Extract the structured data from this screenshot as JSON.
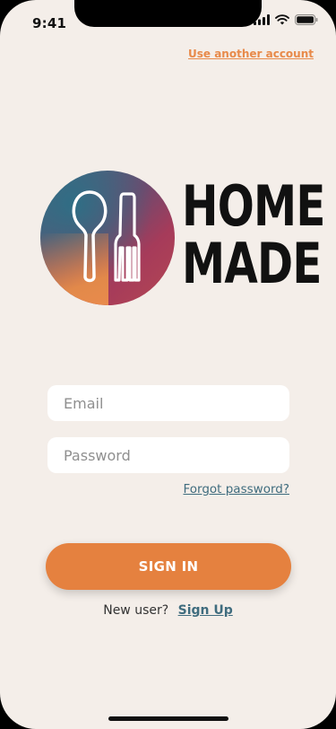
{
  "status_bar": {
    "time": "9:41"
  },
  "header": {
    "use_another_account": "Use another account"
  },
  "logo": {
    "line1": "HOME",
    "line2": "MADE",
    "icon": "spoon-fork-icon"
  },
  "form": {
    "email_placeholder": "Email",
    "password_placeholder": "Password",
    "forgot_password": "Forgot password?",
    "sign_in_label": "SIGN IN"
  },
  "footer": {
    "new_user_text": "New user?",
    "sign_up_link": "Sign Up"
  },
  "colors": {
    "background": "#f4eee9",
    "accent_orange": "#e5813f",
    "link_teal": "#3f6c7e"
  }
}
